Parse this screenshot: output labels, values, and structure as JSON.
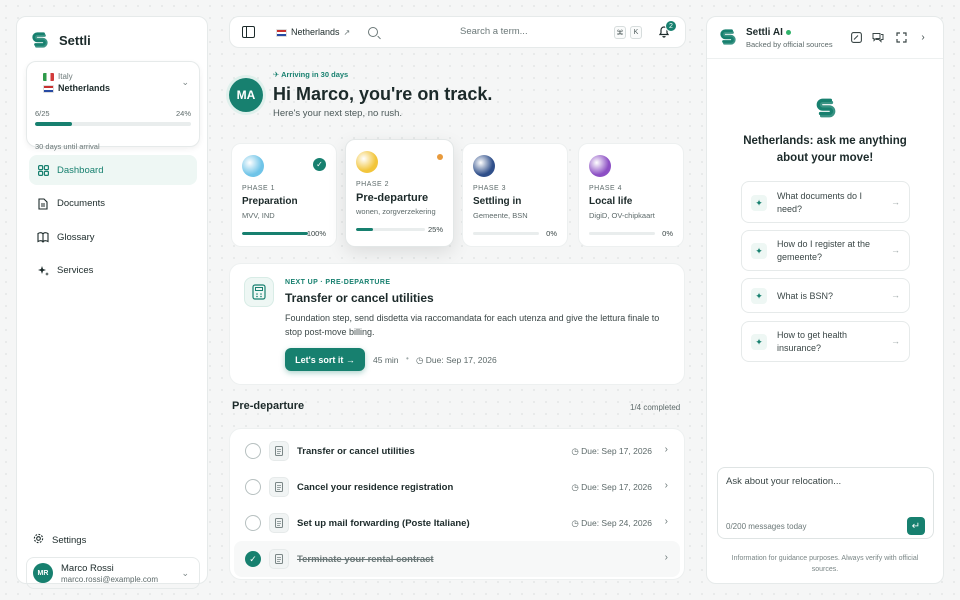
{
  "brand": {
    "name": "Settli",
    "accent": "#17806f"
  },
  "destination": {
    "origin": "Italy",
    "target": "Netherlands",
    "steps": "6/25",
    "percent_label": "24%",
    "progress": 0.24,
    "subtitle": "30 days until arrival"
  },
  "nav": {
    "items": [
      {
        "label": "Dashboard",
        "icon": "grid-icon",
        "active": true
      },
      {
        "label": "Documents",
        "icon": "file-icon"
      },
      {
        "label": "Glossary",
        "icon": "book-icon"
      },
      {
        "label": "Services",
        "icon": "sparkle-icon"
      }
    ],
    "settings": "Settings"
  },
  "user": {
    "initials": "MR",
    "name": "Marco Rossi",
    "email": "marco.rossi@example.com"
  },
  "topbar": {
    "country": "Netherlands",
    "search_placeholder": "Search a term...",
    "kbd1": "⌘",
    "kbd2": "K",
    "notifications": "2"
  },
  "greeting": {
    "initials": "MA",
    "arriving": "Arriving in 30 days",
    "title": "Hi Marco, you're on track.",
    "subtitle": "Here's your next step, no rush."
  },
  "phases": [
    {
      "label": "PHASE 1",
      "name": "Preparation",
      "sub": "MVV, IND",
      "pct_label": "100%",
      "progress": 1.0,
      "status": "done",
      "color": "#6fc4e8"
    },
    {
      "label": "PHASE 2",
      "name": "Pre-departure",
      "sub": "wonen, zorgverzekering",
      "pct_label": "25%",
      "progress": 0.25,
      "status": "active",
      "color": "#f2c53b"
    },
    {
      "label": "PHASE 3",
      "name": "Settling in",
      "sub": "Gemeente, BSN",
      "pct_label": "0%",
      "progress": 0,
      "status": "todo",
      "color": "#2f4f8a"
    },
    {
      "label": "PHASE 4",
      "name": "Local life",
      "sub": "DigiD, OV-chipkaart",
      "pct_label": "0%",
      "progress": 0,
      "status": "todo",
      "color": "#8c4fc4"
    }
  ],
  "next_up": {
    "label": "NEXT UP · PRE-DEPARTURE",
    "title": "Transfer or cancel utilities",
    "description": "Foundation step, send disdetta via raccomandata for each utenza and give the lettura finale to stop post-move billing.",
    "button": "Let's sort it →",
    "duration": "45 min",
    "separator": "•",
    "due": "Due: Sep 17, 2026"
  },
  "section": {
    "title": "Pre-departure",
    "count": "1/4 completed"
  },
  "tasks": [
    {
      "title": "Transfer or cancel utilities",
      "due": "Due: Sep 17, 2026",
      "done": false
    },
    {
      "title": "Cancel your residence registration",
      "due": "Due: Sep 17, 2026",
      "done": false
    },
    {
      "title": "Set up mail forwarding (Poste Italiane)",
      "due": "Due: Sep 24, 2026",
      "done": false
    },
    {
      "title": "Terminate your rental contract",
      "due": "",
      "done": true
    }
  ],
  "ai": {
    "title": "Settli AI",
    "subtitle": "Backed by official sources",
    "heading": "Netherlands: ask me anything about your move!",
    "suggestions": [
      "What documents do I need?",
      "How do I register at the gemeente?",
      "What is BSN?",
      "How to get health insurance?"
    ],
    "input_placeholder": "Ask about your relocation...",
    "counter": "0/200 messages today",
    "disclaimer": "Information for guidance purposes. Always verify with official sources."
  }
}
